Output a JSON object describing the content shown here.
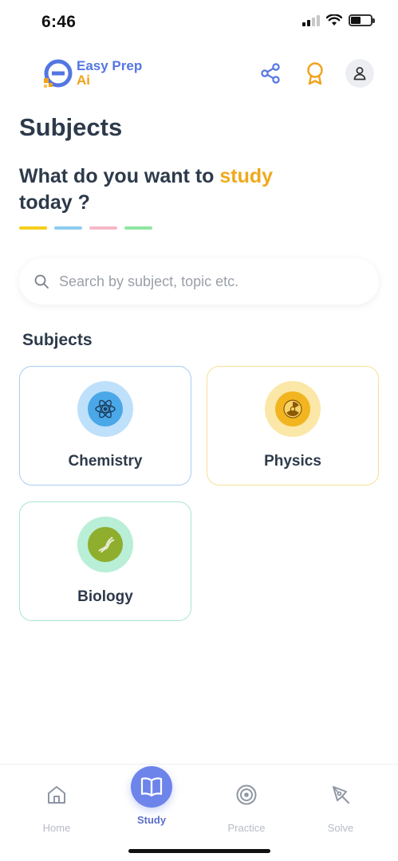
{
  "status_bar": {
    "time": "6:46"
  },
  "header": {
    "logo_line1": "Easy Prep",
    "logo_line2": "Ai",
    "icons": [
      "share-icon",
      "award-icon",
      "user-icon"
    ]
  },
  "page": {
    "title": "Subjects",
    "prompt_prefix": "What do you want to ",
    "prompt_accent": "study",
    "prompt_suffix": "today ?",
    "dash_colors": [
      "#f5cf1d",
      "#8ecdf0",
      "#f6b9c7",
      "#8fe6a3"
    ]
  },
  "search": {
    "placeholder": "Search by subject, topic etc."
  },
  "section_label": "Subjects",
  "subjects": [
    {
      "label": "Chemistry",
      "icon": "atom-icon",
      "border": "#a8cdf1",
      "halo": "#bfe0fb",
      "orb": "#4aa8e8"
    },
    {
      "label": "Physics",
      "icon": "radiation-icon",
      "border": "#f8df97",
      "halo": "#fbe7a7",
      "orb": "#f2b51f"
    },
    {
      "label": "Biology",
      "icon": "dna-icon",
      "border": "#a8e6cc",
      "halo": "#b8efd6",
      "orb": "#8fae2e"
    }
  ],
  "bottom_nav": [
    {
      "label": "Home",
      "icon": "home-icon",
      "active": false
    },
    {
      "label": "Study",
      "icon": "book-icon",
      "active": true
    },
    {
      "label": "Practice",
      "icon": "target-icon",
      "active": false
    },
    {
      "label": "Solve",
      "icon": "pen-tool-icon",
      "active": false
    }
  ],
  "colors": {
    "brand_blue": "#5476e3",
    "brand_orange": "#f0a21a",
    "accent_yellow": "#f0a91c",
    "nav_active": "#6d84ea"
  }
}
